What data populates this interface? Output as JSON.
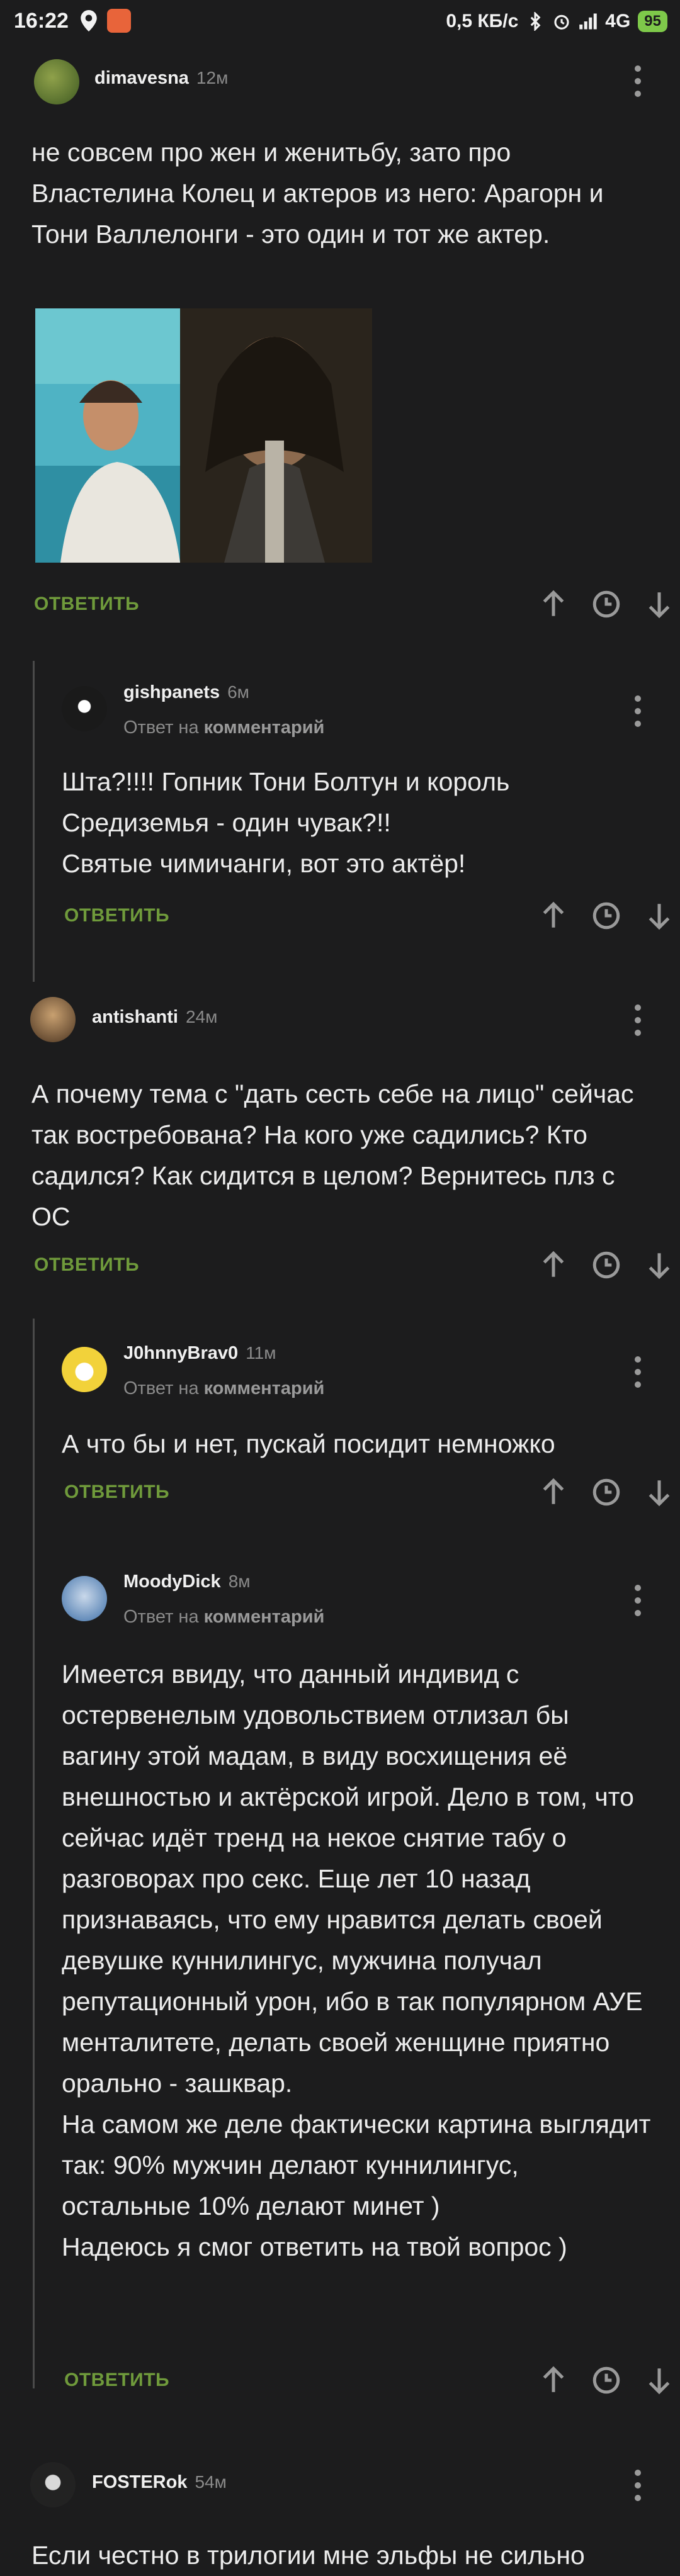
{
  "statusbar": {
    "time": "16:22",
    "speed": "0,5 КБ/с",
    "network": "4G",
    "battery": "95"
  },
  "reply_label": "ОТВЕТИТЬ",
  "reply_to_prefix": "Ответ на",
  "reply_to_link": "комментарий",
  "comments": [
    {
      "author": "dimavesna",
      "time": "12м",
      "text": "не совсем про жен и женитьбу, зато про Властелина Колец  и актеров из него: Арагорн и Тони Валлелонги - это один и тот же актер."
    },
    {
      "author": "gishpanets",
      "time": "6м",
      "text": "Шта?!!!! Гопник Тони Болтун и король Средиземья - один чувак?!!\nСвятые чимичанги, вот это актёр!"
    },
    {
      "author": "antishanti",
      "time": "24м",
      "text": "А почему тема с \"дать сесть себе на лицо\" сейчас так востребована? На кого уже садились? Кто садился? Как сидится в целом? Вернитесь плз с ОС"
    },
    {
      "author": "J0hnnyBrav0",
      "time": "11м",
      "text": "А что бы и нет, пускай посидит немножко"
    },
    {
      "author": "MoodyDick",
      "time": "8м",
      "text": "Имеется ввиду, что данный индивид с остервенелым удовольствием отлизал бы вагину этой мадам, в виду восхищения её внешностью и актёрской игрой. Дело в том, что сейчас идёт тренд на некое снятие табу о разговорах про секс. Еще лет 10 назад признаваясь, что ему нравится делать своей девушке куннилингус, мужчина получал репутационный урон, ибо в так популярном АУЕ менталитете, делать своей женщине приятно орально - зашквар.\nНа самом же деле фактически картина выглядит так: 90% мужчин делают куннилингус, остальные 10% делают минет )\nНадеюсь я смог ответить на твой вопрос )"
    },
    {
      "author": "FOSTERok",
      "time": "54м",
      "text": "Если честно в трилогии мне эльфы не сильно"
    }
  ],
  "colors": {
    "background": "#1c1c1d",
    "reply_green": "#6f9a3b",
    "thread_line": "#4a4a4a"
  }
}
